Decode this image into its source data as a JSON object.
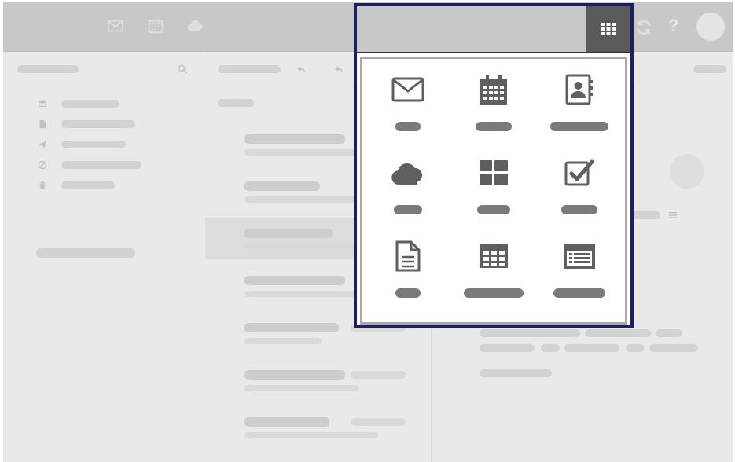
{
  "colors": {
    "frame": "#1b1f66",
    "icon": "#5f5f5f",
    "placeholder_label": "#7a7a7a",
    "topbar": "#c8c8c8",
    "background_app": "#e9e9e9"
  },
  "topbar": {
    "left_icons": [
      "mail-icon",
      "calendar-icon",
      "cloud-icon"
    ],
    "right_icons": [
      "apps-grid-icon",
      "refresh-icon",
      "help-icon",
      "avatar"
    ],
    "help_glyph": "?"
  },
  "background": {
    "folder_icons": [
      "inbox-icon",
      "file-icon",
      "send-icon",
      "blocked-icon",
      "trash-icon"
    ]
  },
  "launcher": {
    "apps": [
      {
        "icon": "mail-icon",
        "label": ""
      },
      {
        "icon": "calendar-icon",
        "label": ""
      },
      {
        "icon": "contacts-icon",
        "label": ""
      },
      {
        "icon": "cloud-icon",
        "label": ""
      },
      {
        "icon": "dashboard-icon",
        "label": ""
      },
      {
        "icon": "tasks-icon",
        "label": ""
      },
      {
        "icon": "document-icon",
        "label": ""
      },
      {
        "icon": "spreadsheet-icon",
        "label": ""
      },
      {
        "icon": "presentation-icon",
        "label": ""
      }
    ]
  }
}
